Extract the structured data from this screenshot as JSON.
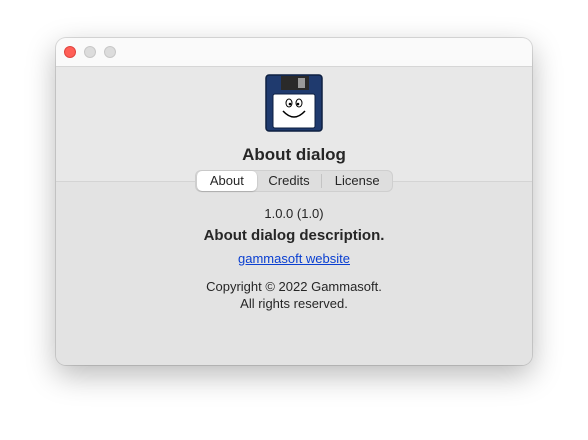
{
  "window": {
    "controls": [
      "close",
      "minimize",
      "zoom"
    ]
  },
  "app": {
    "icon": "floppy-disk-smiley-icon",
    "title": "About dialog"
  },
  "tabs": [
    {
      "label": "About",
      "selected": true
    },
    {
      "label": "Credits",
      "selected": false
    },
    {
      "label": "License",
      "selected": false
    }
  ],
  "about": {
    "version": "1.0.0 (1.0)",
    "description": "About dialog description.",
    "website_label": "gammasoft website",
    "copyright_line1": "Copyright © 2022 Gammasoft.",
    "copyright_line2": "All rights reserved."
  },
  "colors": {
    "close": "#ff5f57",
    "link": "#0a3fd1",
    "icon_body": "#1f3a6e"
  }
}
